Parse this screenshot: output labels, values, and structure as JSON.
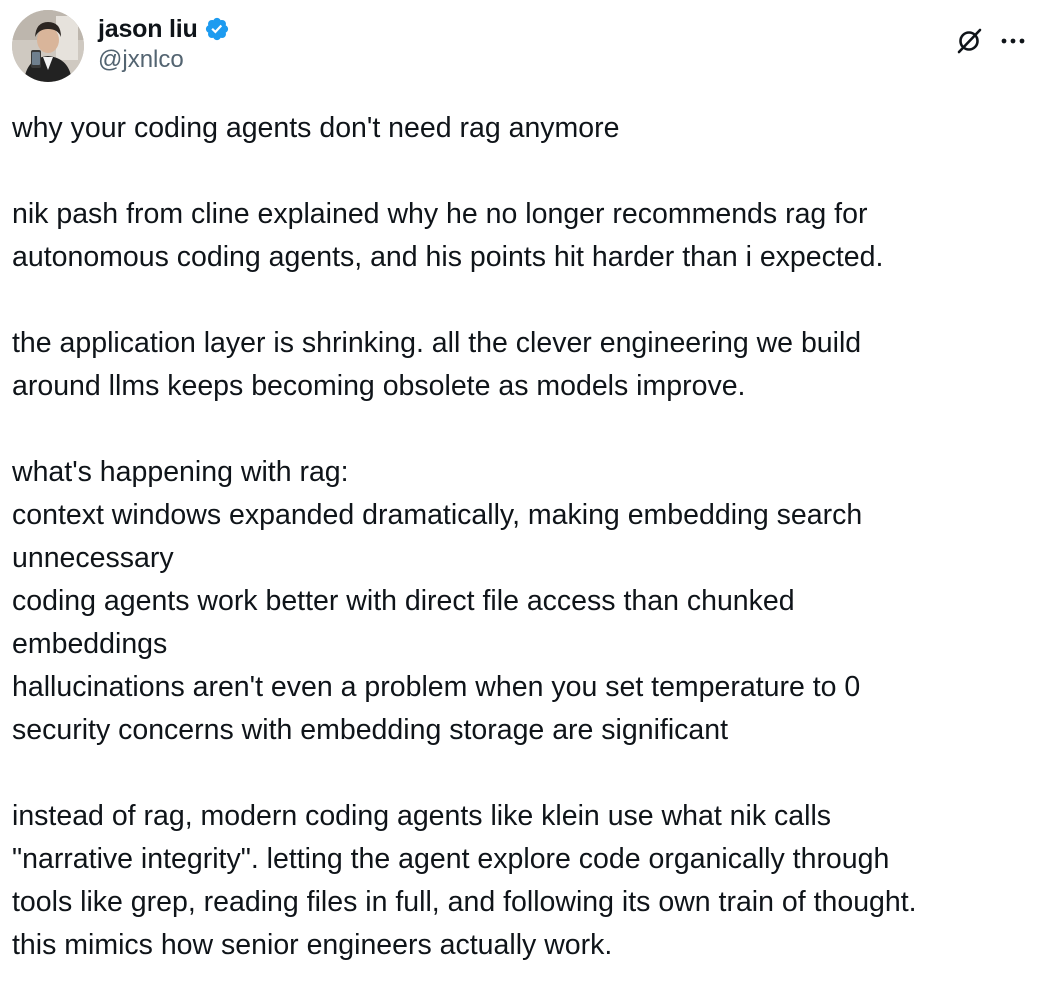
{
  "author": {
    "display_name": "jason liu",
    "handle": "@jxnlco",
    "verified": true,
    "verified_color": "#1d9bf0",
    "avatar_icon": "profile-photo"
  },
  "actions": {
    "grok_icon": "grok-icon",
    "more_icon": "more-horizontal-icon"
  },
  "tweet": {
    "paragraphs": [
      {
        "lines": [
          "why your coding agents don't need rag anymore"
        ]
      },
      {
        "lines": [
          "nik pash from cline explained why he no longer recommends rag for",
          "autonomous coding agents, and his points hit harder than i expected."
        ]
      },
      {
        "lines": [
          "the application layer is shrinking. all the clever engineering we build",
          "around llms keeps becoming obsolete as models improve."
        ]
      },
      {
        "lines": [
          "what's happening with rag:",
          "context windows expanded dramatically, making embedding search",
          "unnecessary",
          "coding agents work better with direct file access than chunked",
          "embeddings",
          "hallucinations aren't even a problem when you set temperature to 0",
          "security concerns with embedding storage are significant"
        ]
      },
      {
        "lines": [
          "instead of rag, modern coding agents like klein use what nik calls",
          "\"narrative integrity\". letting the agent explore code organically through",
          "tools like grep, reading files in full, and following its own train of thought.",
          "this mimics how senior engineers actually work."
        ]
      }
    ]
  },
  "colors": {
    "text_primary": "#0f1419",
    "text_secondary": "#536471",
    "accent": "#1d9bf0"
  }
}
